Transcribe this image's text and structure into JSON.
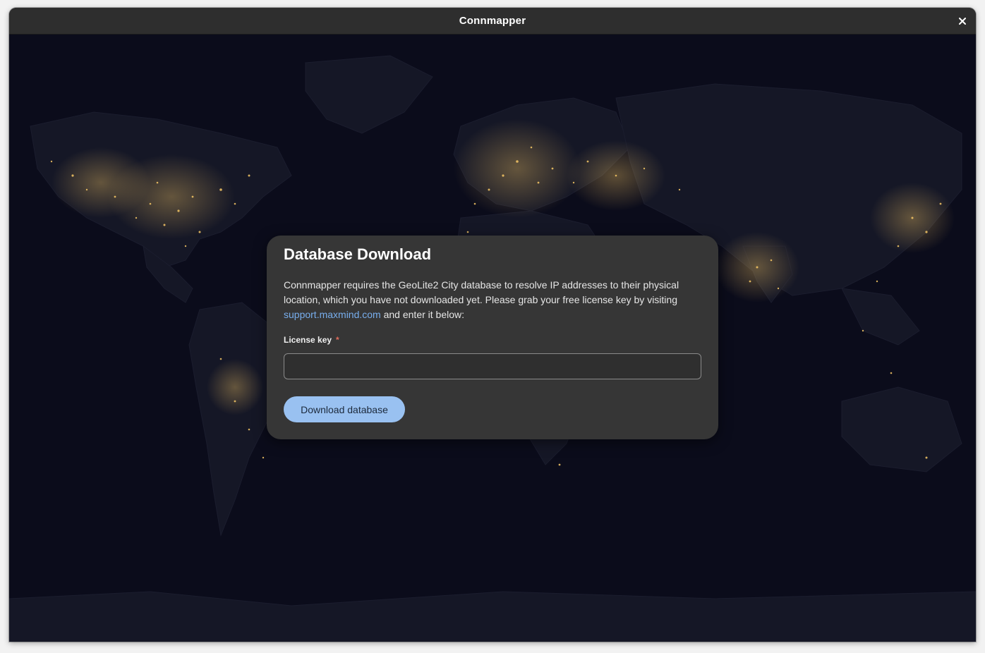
{
  "window": {
    "title": "Connmapper"
  },
  "dialog": {
    "title": "Database Download",
    "body_before_link": "Connmapper requires the GeoLite2 City database to resolve IP addresses to their physical location, which you have not downloaded yet. Please grab your free license key by visiting ",
    "link_text": "support.maxmind.com",
    "body_after_link": " and enter it below:",
    "field_label": "License key",
    "required_marker": "*",
    "input_value": "",
    "button_label": "Download database"
  },
  "icons": {
    "close": "close-icon",
    "map": "world-night-map"
  },
  "colors": {
    "accent": "#99c1f1",
    "link": "#78aeed",
    "required": "#e06c5c",
    "dialog_bg": "#363636",
    "map_bg": "#0b0c1b",
    "city_lights": "#f7c866"
  }
}
